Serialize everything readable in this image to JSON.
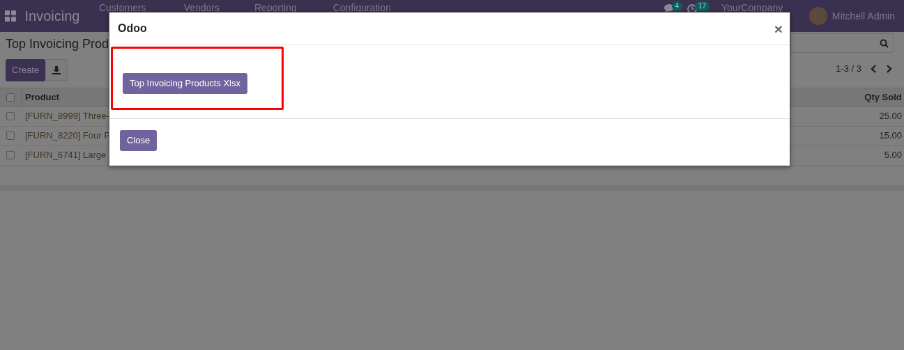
{
  "navbar": {
    "app_name": "Invoicing",
    "menu": [
      "Customers",
      "Vendors",
      "Reporting",
      "Configuration"
    ],
    "messages_badge": "4",
    "activities_badge": "17",
    "company": "YourCompany",
    "user": "Mitchell Admin"
  },
  "control_panel": {
    "title": "Top Invoicing Prod",
    "create_button": "Create",
    "pager": "1-3 / 3"
  },
  "table": {
    "all_checked": false,
    "columns": [
      "Product",
      "Qty Sold"
    ],
    "rows": [
      {
        "product": "[FURN_8999] Three-",
        "qty": "25.00",
        "checked": false
      },
      {
        "product": "[FURN_8220] Four P",
        "qty": "15.00",
        "checked": false
      },
      {
        "product": "[FURN_6741] Large",
        "qty": "5.00",
        "checked": false
      }
    ]
  },
  "dialog": {
    "title": "Odoo",
    "close_icon": "×",
    "action_button": "Top Invoicing Products Xlsx",
    "highlighted": true,
    "footer_button": "Close"
  }
}
